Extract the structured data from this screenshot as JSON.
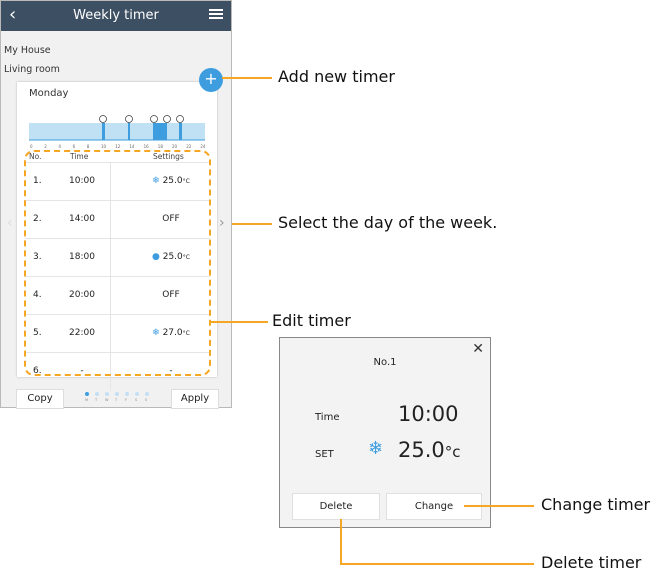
{
  "app": {
    "title": "Weekly timer",
    "breadcrumb_home": "My House",
    "breadcrumb_room": "Living room"
  },
  "timer_card": {
    "day": "Monday",
    "chart_hours": [
      "0",
      "2",
      "4",
      "6",
      "8",
      "10",
      "12",
      "14",
      "16",
      "18",
      "20",
      "22",
      "24"
    ],
    "columns": {
      "no": "No.",
      "time": "Time",
      "settings": "Settings"
    },
    "rows": [
      {
        "no": "1.",
        "time": "10:00",
        "mode": "cool",
        "temp": "25.0",
        "unit": "°C"
      },
      {
        "no": "2.",
        "time": "14:00",
        "mode": "off",
        "text": "OFF"
      },
      {
        "no": "3.",
        "time": "18:00",
        "mode": "dry",
        "temp": "25.0",
        "unit": "°C"
      },
      {
        "no": "4.",
        "time": "20:00",
        "mode": "off",
        "text": "OFF"
      },
      {
        "no": "5.",
        "time": "22:00",
        "mode": "cool",
        "temp": "27.0",
        "unit": "°C"
      },
      {
        "no": "6.",
        "time": "-",
        "mode": "none",
        "text": "-"
      }
    ]
  },
  "footer": {
    "copy_label": "Copy",
    "apply_label": "Apply",
    "day_letters": [
      "M",
      "T",
      "W",
      "T",
      "F",
      "S",
      "S"
    ]
  },
  "callouts": {
    "add_timer": "Add new timer",
    "select_day": "Select the day of the week.",
    "edit_timer": "Edit timer",
    "change_timer": "Change timer",
    "delete_timer": "Delete timer"
  },
  "edit_dialog": {
    "number": "No.1",
    "time_label": "Time",
    "time_value": "10:00",
    "set_label": "SET",
    "set_value": "25.0",
    "set_unit": "°c",
    "delete_label": "Delete",
    "change_label": "Change"
  },
  "colors": {
    "header": "#3d4f63",
    "accent": "#3d9ddf",
    "callout_line": "#f5a623",
    "chart_fill": "#bfe1f3"
  },
  "icons": {
    "back": "chevron-left-icon",
    "menu": "hamburger-menu-icon",
    "add": "plus-icon",
    "cool": "snowflake-icon",
    "dry": "droplet-icon",
    "close": "close-icon"
  }
}
